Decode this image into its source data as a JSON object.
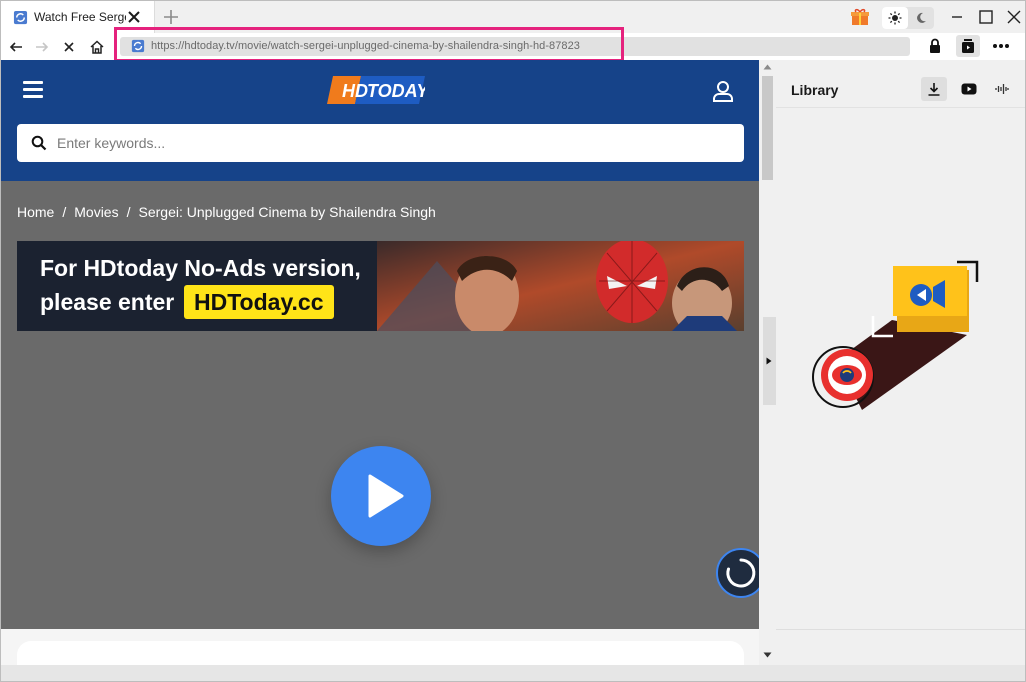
{
  "browser": {
    "tab": {
      "title": "Watch Free Sergei"
    },
    "address_bar": {
      "url": "https://hdtoday.tv/movie/watch-sergei-unplugged-cinema-by-shailendra-singh-hd-87823"
    },
    "colors": {
      "highlight": "#e5227d"
    }
  },
  "site": {
    "logo_text": "HD TODAY",
    "search": {
      "placeholder": "Enter keywords..."
    },
    "breadcrumb": [
      "Home",
      "Movies",
      "Sergei: Unplugged Cinema by Shailendra Singh"
    ],
    "breadcrumb_separator": "/",
    "banner": {
      "line1": "For HDtoday No-Ads version,",
      "line2": "please enter",
      "cta": "HDToday.cc"
    },
    "colors": {
      "header": "#164389",
      "play": "#3d85f0",
      "banner_cta": "#ffe418"
    }
  },
  "library_panel": {
    "title": "Library",
    "tabs": [
      "download-icon",
      "youtube-icon",
      "audio-wave-icon"
    ]
  }
}
